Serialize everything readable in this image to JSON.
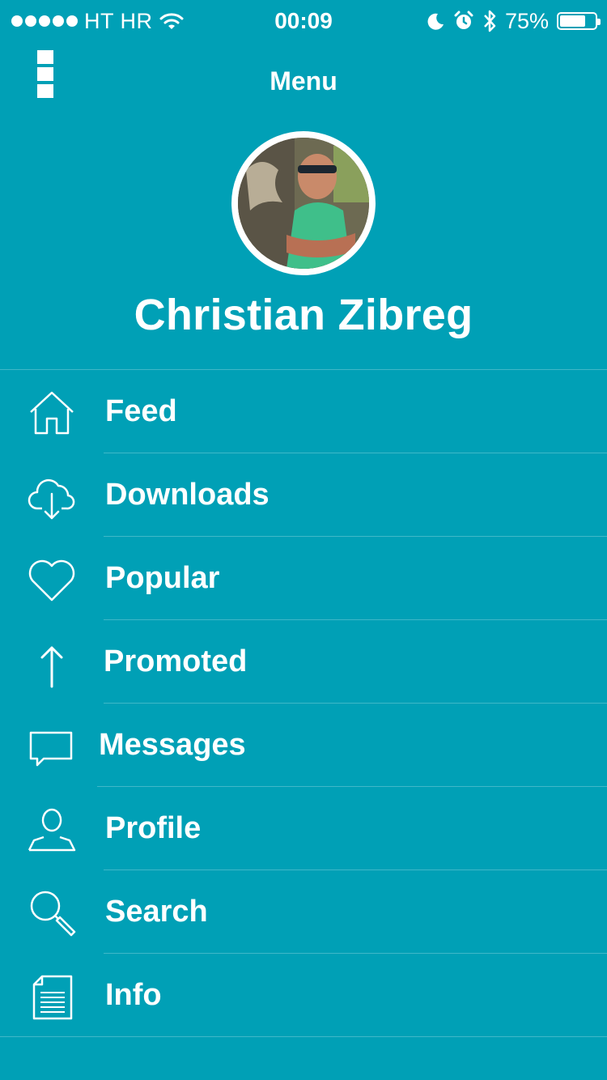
{
  "status_bar": {
    "carrier": "HT HR",
    "time": "00:09",
    "battery_percent": "75%",
    "battery_level": 0.75,
    "icons": [
      "signal-dots-icon",
      "wifi-icon",
      "moon-icon",
      "alarm-icon",
      "bluetooth-icon",
      "battery-icon"
    ]
  },
  "nav": {
    "title": "Menu",
    "menu_icon": "menu-icon"
  },
  "profile": {
    "name": "Christian Zibreg",
    "avatar": "avatar-photo"
  },
  "menu": {
    "items": [
      {
        "label": "Feed",
        "icon": "home-icon"
      },
      {
        "label": "Downloads",
        "icon": "cloud-download-icon"
      },
      {
        "label": "Popular",
        "icon": "heart-icon"
      },
      {
        "label": "Promoted",
        "icon": "arrow-up-icon"
      },
      {
        "label": "Messages",
        "icon": "message-icon"
      },
      {
        "label": "Profile",
        "icon": "person-icon"
      },
      {
        "label": "Search",
        "icon": "search-icon"
      },
      {
        "label": "Info",
        "icon": "document-icon"
      }
    ]
  },
  "colors": {
    "background": "#00a0b6",
    "foreground": "#ffffff"
  }
}
